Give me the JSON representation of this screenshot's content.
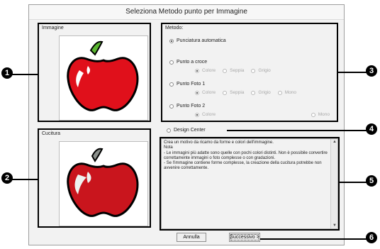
{
  "window": {
    "title": "Seleziona Metodo punto per Immagine"
  },
  "image_panel": {
    "label": "Immagine"
  },
  "stitch_panel": {
    "label": "Cucitura"
  },
  "method": {
    "label": "Metodo:",
    "options": [
      {
        "label": "Punciatura automatica",
        "checked": true
      },
      {
        "label": "Punto a croce",
        "checked": false,
        "sub": [
          "Colore",
          "Seppia",
          "Grigio"
        ]
      },
      {
        "label": "Punto Foto 1",
        "checked": false,
        "sub": [
          "Colore",
          "Seppia",
          "Grigio",
          "Mono"
        ]
      },
      {
        "label": "Punto Foto 2",
        "checked": false,
        "sub": [
          "Colore",
          "Mono"
        ]
      }
    ]
  },
  "design_center": {
    "label": "Design Center"
  },
  "description": {
    "line1": "Crea un motivo da ricamo da forme e colori dell'immagine.",
    "line2": "Nota",
    "line3": "- Le immagini più adatte sono quelle con pochi colori distinti. Non è possibile convertire correttamente immagini o foto complesse o con gradazioni.",
    "line4": "- Se l'immagine contiene forme complesse, la creazione della cucitura potrebbe non avvenire correttamente."
  },
  "buttons": {
    "cancel": "Annulla",
    "next": "Successivo >"
  },
  "callouts": [
    "1",
    "2",
    "3",
    "4",
    "5",
    "6"
  ],
  "colors": {
    "apple_red": "#e0101b",
    "leaf_green": "#5ab631",
    "callout": "#000000"
  }
}
